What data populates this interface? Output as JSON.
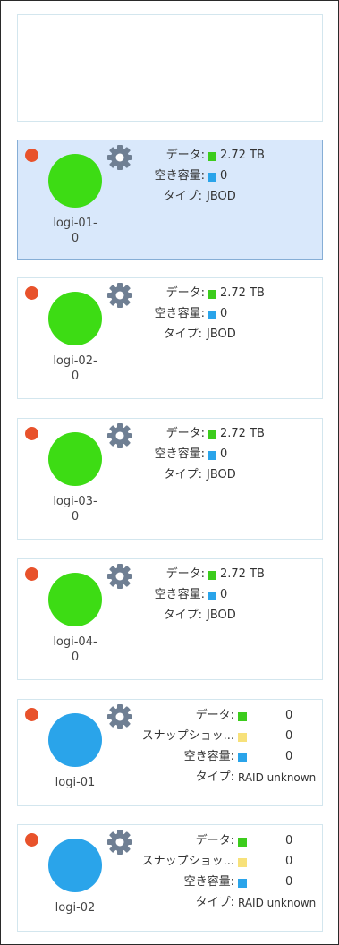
{
  "colors": {
    "status_dot": "#e8522b",
    "disk_jbod": "#3ddc14",
    "disk_raid": "#2aa4ea",
    "swatch_data": "#3ccc1c",
    "swatch_snapshot": "#f7e17a",
    "swatch_free": "#2aa4ea",
    "gear": "#6f7f93"
  },
  "labels": {
    "data": "データ:",
    "snapshot": "スナップショッ...",
    "free": "空き容量:",
    "type": "タイプ:"
  },
  "cards": [
    {
      "disk_line1": "logi-01-",
      "disk_line2": "0",
      "data": "2.72 TB",
      "free": "0",
      "type": "JBOD"
    },
    {
      "disk_line1": "logi-02-",
      "disk_line2": "0",
      "data": "2.72 TB",
      "free": "0",
      "type": "JBOD"
    },
    {
      "disk_line1": "logi-03-",
      "disk_line2": "0",
      "data": "2.72 TB",
      "free": "0",
      "type": "JBOD"
    },
    {
      "disk_line1": "logi-04-",
      "disk_line2": "0",
      "data": "2.72 TB",
      "free": "0",
      "type": "JBOD"
    },
    {
      "disk_line1": "logi-01",
      "data": "0",
      "snapshot": "0",
      "free": "0",
      "type": "RAID unknown"
    },
    {
      "disk_line1": "logi-02",
      "data": "0",
      "snapshot": "0",
      "free": "0",
      "type": "RAID unknown"
    }
  ]
}
